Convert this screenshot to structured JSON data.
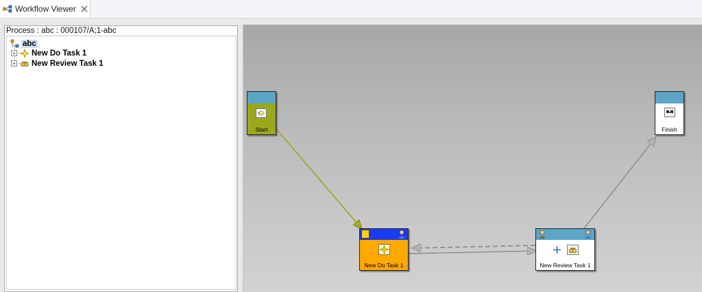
{
  "tab": {
    "title": "Workflow Viewer"
  },
  "process": {
    "title": "Process : abc : 000107/A;1-abc"
  },
  "tree": {
    "root": "abc",
    "nodes": [
      {
        "label": "New Do Task 1",
        "icon": "do-task-icon"
      },
      {
        "label": "New Review Task 1",
        "icon": "review-task-icon"
      }
    ]
  },
  "diagram": {
    "nodes": {
      "start": {
        "label": "Start"
      },
      "finish": {
        "label": "Finish"
      },
      "do_task": {
        "label": "New Do Task 1"
      },
      "review_task": {
        "label": "New Review Task 1"
      }
    },
    "colors": {
      "header_blue": "#5da5c6",
      "start_body": "#9ba81c",
      "do_header": "#1a3cf0",
      "do_body": "#ffa800",
      "edge_start": "#a0a020",
      "edge_gray": "#8a8a8a"
    }
  }
}
